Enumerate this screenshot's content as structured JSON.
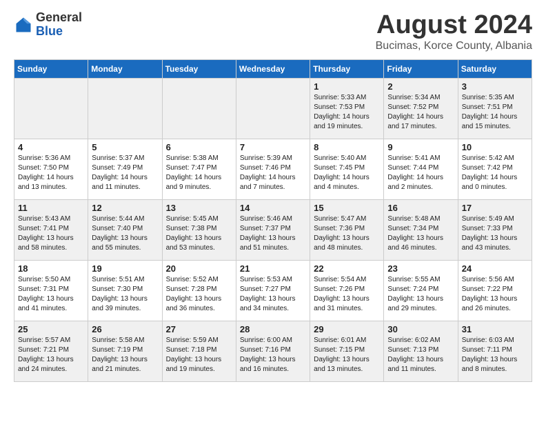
{
  "logo": {
    "general": "General",
    "blue": "Blue"
  },
  "title": "August 2024",
  "location": "Bucimas, Korce County, Albania",
  "days_of_week": [
    "Sunday",
    "Monday",
    "Tuesday",
    "Wednesday",
    "Thursday",
    "Friday",
    "Saturday"
  ],
  "weeks": [
    [
      {
        "day": "",
        "info": ""
      },
      {
        "day": "",
        "info": ""
      },
      {
        "day": "",
        "info": ""
      },
      {
        "day": "",
        "info": ""
      },
      {
        "day": "1",
        "info": "Sunrise: 5:33 AM\nSunset: 7:53 PM\nDaylight: 14 hours\nand 19 minutes."
      },
      {
        "day": "2",
        "info": "Sunrise: 5:34 AM\nSunset: 7:52 PM\nDaylight: 14 hours\nand 17 minutes."
      },
      {
        "day": "3",
        "info": "Sunrise: 5:35 AM\nSunset: 7:51 PM\nDaylight: 14 hours\nand 15 minutes."
      }
    ],
    [
      {
        "day": "4",
        "info": "Sunrise: 5:36 AM\nSunset: 7:50 PM\nDaylight: 14 hours\nand 13 minutes."
      },
      {
        "day": "5",
        "info": "Sunrise: 5:37 AM\nSunset: 7:49 PM\nDaylight: 14 hours\nand 11 minutes."
      },
      {
        "day": "6",
        "info": "Sunrise: 5:38 AM\nSunset: 7:47 PM\nDaylight: 14 hours\nand 9 minutes."
      },
      {
        "day": "7",
        "info": "Sunrise: 5:39 AM\nSunset: 7:46 PM\nDaylight: 14 hours\nand 7 minutes."
      },
      {
        "day": "8",
        "info": "Sunrise: 5:40 AM\nSunset: 7:45 PM\nDaylight: 14 hours\nand 4 minutes."
      },
      {
        "day": "9",
        "info": "Sunrise: 5:41 AM\nSunset: 7:44 PM\nDaylight: 14 hours\nand 2 minutes."
      },
      {
        "day": "10",
        "info": "Sunrise: 5:42 AM\nSunset: 7:42 PM\nDaylight: 14 hours\nand 0 minutes."
      }
    ],
    [
      {
        "day": "11",
        "info": "Sunrise: 5:43 AM\nSunset: 7:41 PM\nDaylight: 13 hours\nand 58 minutes."
      },
      {
        "day": "12",
        "info": "Sunrise: 5:44 AM\nSunset: 7:40 PM\nDaylight: 13 hours\nand 55 minutes."
      },
      {
        "day": "13",
        "info": "Sunrise: 5:45 AM\nSunset: 7:38 PM\nDaylight: 13 hours\nand 53 minutes."
      },
      {
        "day": "14",
        "info": "Sunrise: 5:46 AM\nSunset: 7:37 PM\nDaylight: 13 hours\nand 51 minutes."
      },
      {
        "day": "15",
        "info": "Sunrise: 5:47 AM\nSunset: 7:36 PM\nDaylight: 13 hours\nand 48 minutes."
      },
      {
        "day": "16",
        "info": "Sunrise: 5:48 AM\nSunset: 7:34 PM\nDaylight: 13 hours\nand 46 minutes."
      },
      {
        "day": "17",
        "info": "Sunrise: 5:49 AM\nSunset: 7:33 PM\nDaylight: 13 hours\nand 43 minutes."
      }
    ],
    [
      {
        "day": "18",
        "info": "Sunrise: 5:50 AM\nSunset: 7:31 PM\nDaylight: 13 hours\nand 41 minutes."
      },
      {
        "day": "19",
        "info": "Sunrise: 5:51 AM\nSunset: 7:30 PM\nDaylight: 13 hours\nand 39 minutes."
      },
      {
        "day": "20",
        "info": "Sunrise: 5:52 AM\nSunset: 7:28 PM\nDaylight: 13 hours\nand 36 minutes."
      },
      {
        "day": "21",
        "info": "Sunrise: 5:53 AM\nSunset: 7:27 PM\nDaylight: 13 hours\nand 34 minutes."
      },
      {
        "day": "22",
        "info": "Sunrise: 5:54 AM\nSunset: 7:26 PM\nDaylight: 13 hours\nand 31 minutes."
      },
      {
        "day": "23",
        "info": "Sunrise: 5:55 AM\nSunset: 7:24 PM\nDaylight: 13 hours\nand 29 minutes."
      },
      {
        "day": "24",
        "info": "Sunrise: 5:56 AM\nSunset: 7:22 PM\nDaylight: 13 hours\nand 26 minutes."
      }
    ],
    [
      {
        "day": "25",
        "info": "Sunrise: 5:57 AM\nSunset: 7:21 PM\nDaylight: 13 hours\nand 24 minutes."
      },
      {
        "day": "26",
        "info": "Sunrise: 5:58 AM\nSunset: 7:19 PM\nDaylight: 13 hours\nand 21 minutes."
      },
      {
        "day": "27",
        "info": "Sunrise: 5:59 AM\nSunset: 7:18 PM\nDaylight: 13 hours\nand 19 minutes."
      },
      {
        "day": "28",
        "info": "Sunrise: 6:00 AM\nSunset: 7:16 PM\nDaylight: 13 hours\nand 16 minutes."
      },
      {
        "day": "29",
        "info": "Sunrise: 6:01 AM\nSunset: 7:15 PM\nDaylight: 13 hours\nand 13 minutes."
      },
      {
        "day": "30",
        "info": "Sunrise: 6:02 AM\nSunset: 7:13 PM\nDaylight: 13 hours\nand 11 minutes."
      },
      {
        "day": "31",
        "info": "Sunrise: 6:03 AM\nSunset: 7:11 PM\nDaylight: 13 hours\nand 8 minutes."
      }
    ]
  ]
}
